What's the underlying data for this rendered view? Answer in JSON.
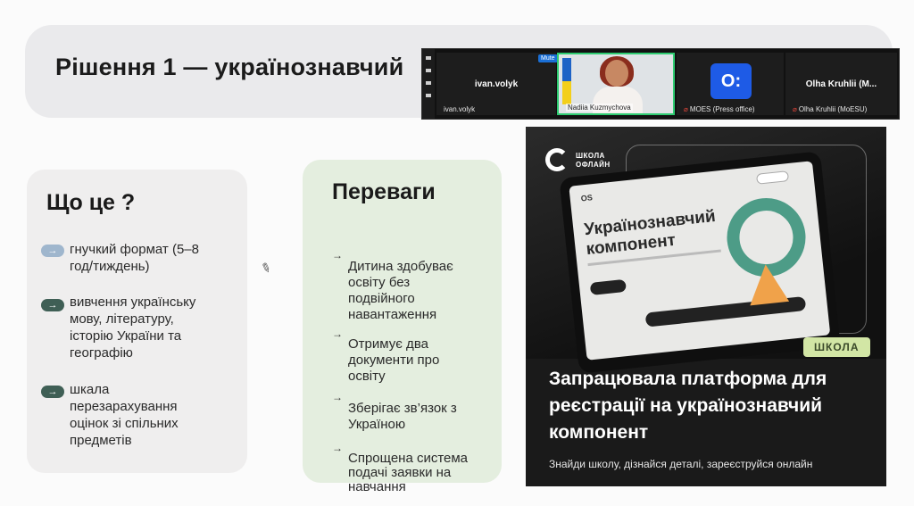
{
  "slide": {
    "title": "Рішення 1 — українознавчий"
  },
  "zoom": {
    "tiles": [
      {
        "display": "ivan.volyk",
        "name": "ivan.volyk"
      },
      {
        "display": "",
        "name": "Nadiia Kuzmychova"
      },
      {
        "display": "",
        "name": "MOES (Press office)"
      },
      {
        "display": "Olha Kruhlii (M...",
        "name": "Olha Kruhlii (MoESU)"
      }
    ],
    "mute_label": "Mute",
    "more_label": "...",
    "logo_glyph": "O:"
  },
  "card1": {
    "heading": "Що це ?",
    "items": [
      {
        "lines": [
          "гнучкий формат (5–8",
          "год/тиждень)"
        ]
      },
      {
        "lines": [
          "вивчення українську",
          "мову, літературу,",
          "історію України та",
          "географію"
        ]
      },
      {
        "lines": [
          "шкала",
          "перезарахування",
          "оцінок зі спільних",
          "предметів"
        ]
      }
    ],
    "arrow": "→"
  },
  "card2": {
    "heading": "Переваги",
    "items": [
      {
        "lines": [
          "Дитина здобуває",
          "освіту без",
          "подвійного",
          "навантаження"
        ]
      },
      {
        "lines": [
          "Отримує два",
          "документи про",
          "освіту"
        ]
      },
      {
        "lines": [
          "Зберігає зв’язок з",
          "Україною"
        ]
      },
      {
        "lines": [
          "Спрощена система",
          "подачі заявки на",
          "навчання"
        ]
      }
    ],
    "arrow": "→"
  },
  "promo": {
    "logo_line1": "ШКОЛА",
    "logo_line2": "ОФЛАЙН",
    "screen_logo": "OS",
    "screen_title1": "Українознавчий",
    "screen_title2": "компонент",
    "badge": "ШКОЛА",
    "headline": [
      "Запрацювала платформа для",
      "реєстрації на українознавчий",
      "компонент"
    ],
    "subline": "Знайди школу, дізнайся деталі, зареєструйся онлайн"
  },
  "colors": {
    "card1_bg": "#efeeee",
    "card2_bg": "#e4eedf",
    "badge_bg": "#d2e6a5",
    "active_speaker": "#2ecc71",
    "moes_blue": "#1e5be6"
  }
}
